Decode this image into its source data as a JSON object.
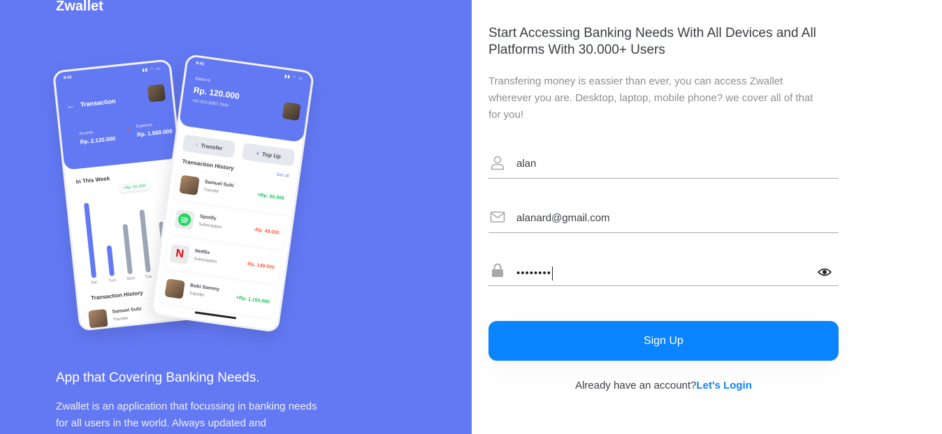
{
  "brand": "Zwallet",
  "left": {
    "heading": "App that Covering Banking Needs.",
    "description": "Zwallet is an application that focussing in banking needs for all users in the world. Always updated and"
  },
  "phone_a": {
    "time": "9:41",
    "title": "Transaction",
    "income_label": "Income",
    "income_value": "Rp. 2.120.000",
    "expense_label": "Expense",
    "expense_value": "Rp. 1.560.000",
    "week_label": "In This Week",
    "bubble": "+Rp. 65.000",
    "day_labels": [
      "Sat",
      "Sun",
      "Mon",
      "Tue"
    ],
    "history_label": "Transaction History",
    "tx_name": "Samuel Suhi",
    "tx_type": "Transfer"
  },
  "phone_b": {
    "time": "9:41",
    "balance_label": "Balance",
    "balance_value": "Rp. 120.000",
    "phone_number": "+62 813-9387-7946",
    "transfer": "Transfer",
    "topup": "Top Up",
    "history_label": "Transaction History",
    "see_all": "See all",
    "transactions": [
      {
        "name": "Samuel Suhi",
        "type": "Transfer",
        "amount": "+Rp. 50.000"
      },
      {
        "name": "Spotify",
        "type": "Subscription",
        "amount": "-Rp. 49.000"
      },
      {
        "name": "Netflix",
        "type": "Subscription",
        "amount": "-Rp. 149.000"
      },
      {
        "name": "Bobi Sammy",
        "type": "Transfer",
        "amount": "+Rp. 1.150.000"
      }
    ]
  },
  "right": {
    "title": "Start Accessing Banking Needs With All Devices and All Platforms With 30.000+ Users",
    "description": "Transfering money is eassier than ever, you can access Zwallet wherever you are. Desktop, laptop, mobile phone? we cover all of that for you!"
  },
  "form": {
    "username_value": "alan",
    "email_value": "alanard@gmail.com",
    "password_mask": "••••••••",
    "signup_label": "Sign Up",
    "have_account": "Already have an account?",
    "login_link": "Let's Login"
  },
  "colors": {
    "panel": "#6379F4",
    "primary": "#0A84FF",
    "positive": "#1EC15F",
    "negative": "#FF5B37"
  }
}
